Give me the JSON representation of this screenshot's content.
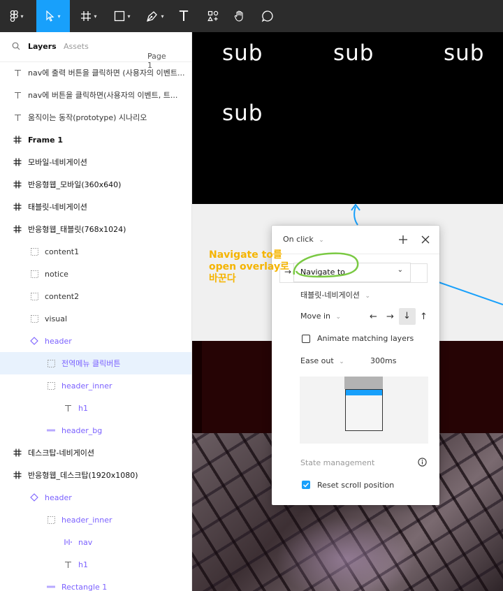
{
  "toolbar": {
    "tools": [
      {
        "name": "figma-menu",
        "icon": "figma-logo-icon",
        "has_dropdown": true
      },
      {
        "name": "move",
        "icon": "cursor-arrow-icon",
        "has_dropdown": true,
        "active": true
      },
      {
        "name": "frame",
        "icon": "frame-hash-icon",
        "has_dropdown": true
      },
      {
        "name": "shape",
        "icon": "rectangle-icon",
        "has_dropdown": true
      },
      {
        "name": "pen",
        "icon": "pen-icon",
        "has_dropdown": true
      },
      {
        "name": "text",
        "icon": "text-t-icon",
        "glyph": "T"
      },
      {
        "name": "resources",
        "icon": "resources-icon"
      },
      {
        "name": "hand",
        "icon": "hand-icon"
      },
      {
        "name": "comment",
        "icon": "comment-bubble-icon"
      }
    ]
  },
  "layers_panel": {
    "tab_layers": "Layers",
    "tab_assets": "Assets",
    "page_selector": "Page 1",
    "rows": [
      {
        "type": "text",
        "label": "nav에 출력 버튼을 클릭하면 (사용자의 이벤트..."
      },
      {
        "type": "text",
        "label": "nav에 버튼을 클릭하면(사용자의 이벤트, 트..."
      },
      {
        "type": "text",
        "label": "움직이는 동작(prototype) 시나리오"
      },
      {
        "type": "frame",
        "label": "Frame 1",
        "bold": true
      },
      {
        "type": "frame",
        "label": "모바일-네비게이션"
      },
      {
        "type": "frame",
        "label": "반응형웹_모바일(360x640)"
      },
      {
        "type": "frame",
        "label": "태블릿-네비게이션"
      },
      {
        "type": "frame",
        "label": "반응형웹_태블릿(768x1024)"
      },
      {
        "type": "group",
        "label": "content1",
        "indent": 1
      },
      {
        "type": "group",
        "label": "notice",
        "indent": 1
      },
      {
        "type": "group",
        "label": "content2",
        "indent": 1
      },
      {
        "type": "group",
        "label": "visual",
        "indent": 1
      },
      {
        "type": "component",
        "label": "header",
        "indent": 1,
        "purple": true
      },
      {
        "type": "group",
        "label": "전역메뉴 클릭버튼",
        "indent": 2,
        "purple": true,
        "selected": true
      },
      {
        "type": "group",
        "label": "header_inner",
        "indent": 2,
        "purple": true
      },
      {
        "type": "text",
        "label": "h1",
        "indent": 3,
        "purple": true
      },
      {
        "type": "rect",
        "label": "header_bg",
        "indent": 2,
        "purple": true
      },
      {
        "type": "frame",
        "label": "데스크탑-네비게이션"
      },
      {
        "type": "frame",
        "label": "반응형웹_데스크탑(1920x1080)"
      },
      {
        "type": "component",
        "label": "header",
        "indent": 1,
        "purple": true
      },
      {
        "type": "group",
        "label": "header_inner",
        "indent": 2,
        "purple": true
      },
      {
        "type": "bars",
        "label": "nav",
        "indent": 3,
        "purple": true
      },
      {
        "type": "text",
        "label": "h1",
        "indent": 3,
        "purple": true
      },
      {
        "type": "rect",
        "label": "Rectangle 1",
        "indent": 2,
        "purple": true
      }
    ]
  },
  "canvas": {
    "sub_texts": [
      "sub",
      "sub",
      "sub",
      "sub"
    ]
  },
  "interaction_popup": {
    "trigger": "On click",
    "action": "Navigate to",
    "destination": "태블릿-네비게이션",
    "animation": "Move in",
    "directions": [
      "←",
      "→",
      "↓",
      "↑"
    ],
    "selected_direction": "↓",
    "animate_matching_layers": "Animate matching layers",
    "easing": "Ease out",
    "duration": "300ms",
    "state_management": "State management",
    "reset_scroll": "Reset scroll position",
    "reset_scroll_checked": true
  },
  "annotation": {
    "line1": "Navigate to를",
    "line2": "open overlay로",
    "line3": "바꾼다"
  },
  "colors": {
    "accent": "#18a0fb",
    "annotation_yellow": "#f5b400",
    "annotation_green": "#7ac943",
    "component_purple": "#7b61ff"
  }
}
